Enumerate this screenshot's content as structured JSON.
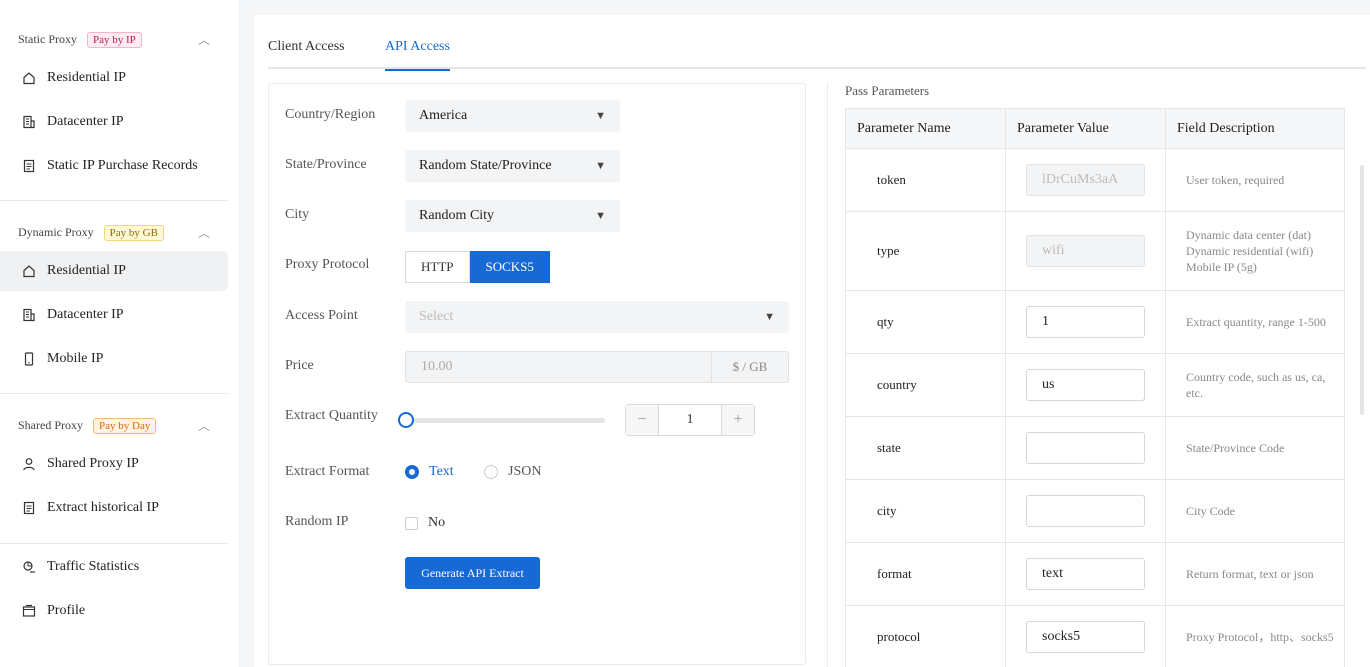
{
  "sidebar": {
    "groups": [
      {
        "title": "Static Proxy",
        "badge": "Pay by IP",
        "badge_color": "#c2185b"
      },
      {
        "title": "Dynamic Proxy",
        "badge": "Pay by GB",
        "badge_color": "#8a6d00"
      },
      {
        "title": "Shared Proxy",
        "badge": "Pay by Day",
        "badge_color": "#e06a00"
      }
    ],
    "items": [
      {
        "label": "Residential IP",
        "icon": "home-icon"
      },
      {
        "label": "Datacenter IP",
        "icon": "building-icon"
      },
      {
        "label": "Static IP Purchase Records",
        "icon": "document-icon"
      },
      {
        "label": "Residential IP",
        "icon": "home-icon",
        "active": true
      },
      {
        "label": "Datacenter IP",
        "icon": "building-icon"
      },
      {
        "label": "Mobile IP",
        "icon": "mobile-icon"
      },
      {
        "label": "Shared Proxy IP",
        "icon": "user-icon"
      },
      {
        "label": "Extract historical IP",
        "icon": "document-icon"
      },
      {
        "label": "Traffic Statistics",
        "icon": "stats-icon"
      },
      {
        "label": "Profile",
        "icon": "profile-icon"
      }
    ]
  },
  "tabs": {
    "client": "Client Access",
    "api": "API Access",
    "active": "API Access"
  },
  "form": {
    "country_label": "Country/Region",
    "country_value": "America",
    "state_label": "State/Province",
    "state_value": "Random State/Province",
    "city_label": "City",
    "city_value": "Random City",
    "protocol_label": "Proxy Protocol",
    "protocol_http": "HTTP",
    "protocol_socks5": "SOCKS5",
    "access_label": "Access Point",
    "access_placeholder": "Select",
    "price_label": "Price",
    "price_value": "10.00",
    "price_unit": "$ / GB",
    "quantity_label": "Extract Quantity",
    "quantity_value": "1",
    "minus": "−",
    "plus": "+",
    "format_label": "Extract Format",
    "format_text": "Text",
    "format_json": "JSON",
    "random_label": "Random IP",
    "random_value": "No",
    "generate_button": "Generate API Extract"
  },
  "params": {
    "title": "Pass Parameters",
    "headers": [
      "Parameter Name",
      "Parameter Value",
      "Field Description"
    ],
    "rows": [
      {
        "name": "token",
        "value": "lDrCuMs3aA",
        "disabled": true,
        "desc": "User token, required"
      },
      {
        "name": "type",
        "value": "wifi",
        "disabled": true,
        "desc": "Dynamic data center (dat) Dynamic residential (wifi) Mobile IP (5g)"
      },
      {
        "name": "qty",
        "value": "1",
        "desc": "Extract quantity, range 1-500"
      },
      {
        "name": "country",
        "value": "us",
        "desc": "Country code, such as us, ca, etc."
      },
      {
        "name": "state",
        "value": "",
        "desc": "State/Province Code"
      },
      {
        "name": "city",
        "value": "",
        "desc": "City Code"
      },
      {
        "name": "format",
        "value": "text",
        "desc": "Return format, text or json"
      },
      {
        "name": "protocol",
        "value": "socks5",
        "desc": "Proxy Protocol，http、socks5"
      }
    ]
  },
  "colors": {
    "accent": "#1769d6",
    "active_bg": "#f0f1f3"
  }
}
